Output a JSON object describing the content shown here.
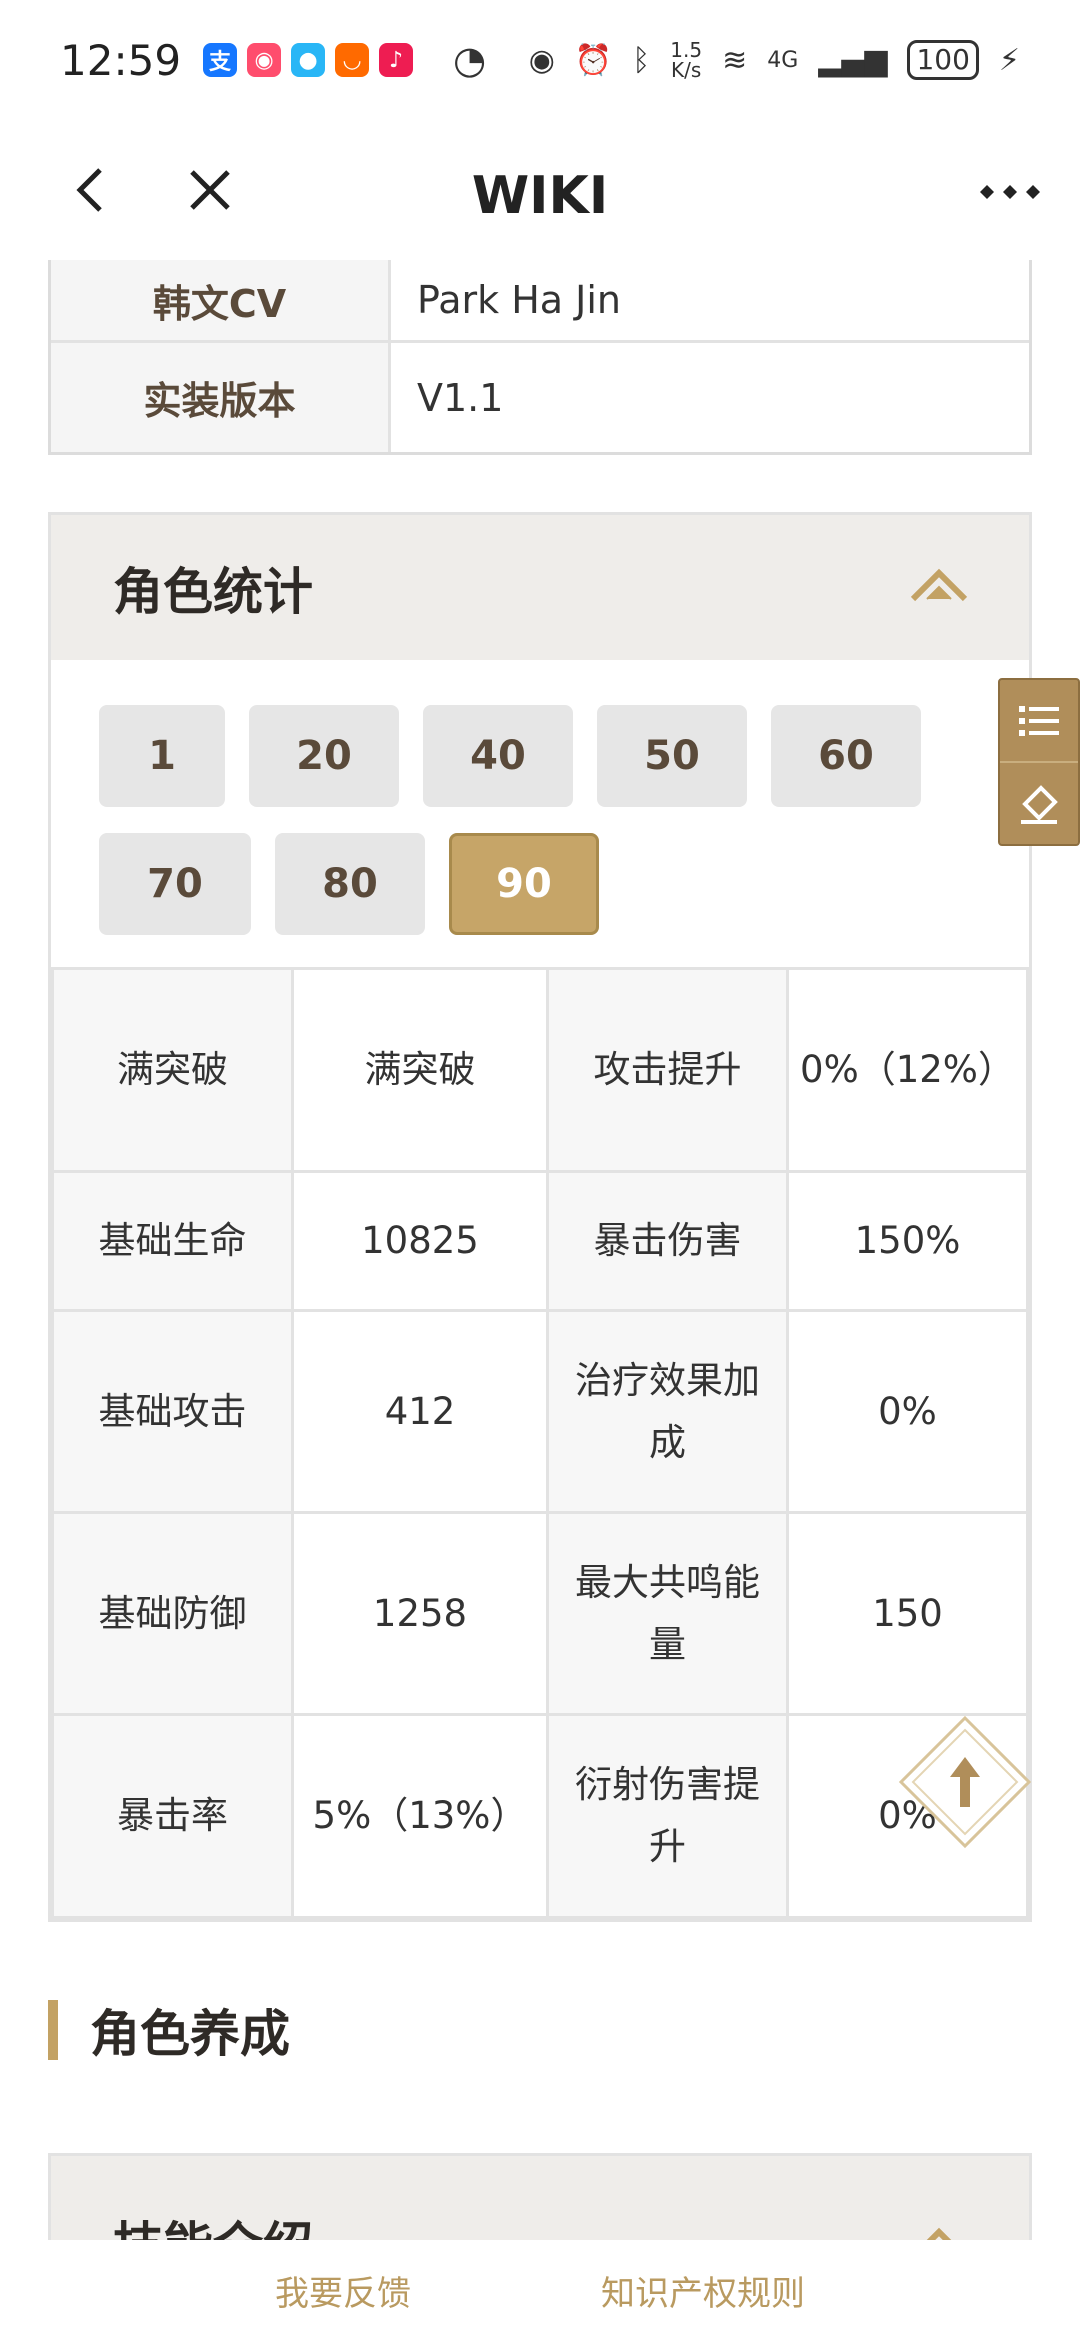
{
  "status_bar": {
    "time": "12:59",
    "apps": [
      {
        "icon": "alipay-icon",
        "glyph": "支",
        "color": "#1677ff"
      },
      {
        "icon": "camera-app-icon",
        "glyph": "◉",
        "color": "#ff4d6d"
      },
      {
        "icon": "cloud-app-icon",
        "glyph": "●",
        "color": "#29b6f6"
      },
      {
        "icon": "taobao-icon",
        "glyph": "◡",
        "color": "#ff6a00"
      },
      {
        "icon": "douyin-icon",
        "glyph": "♪",
        "color": "#ee1d52"
      }
    ],
    "speed_icon": "speedometer-icon",
    "network_speed": "1.5\nK/s",
    "network_type": "4G",
    "battery": "100"
  },
  "nav": {
    "title": "WIKI",
    "back_icon": "back-chevron-icon",
    "close_icon": "close-icon",
    "more_icon": "more-dots-icon"
  },
  "info_table": [
    {
      "label": "韩文CV",
      "value": "Park Ha Jin"
    },
    {
      "label": "实装版本",
      "value": "V1.1"
    }
  ],
  "stats_panel": {
    "title": "角色统计",
    "levels": [
      "1",
      "20",
      "40",
      "50",
      "60",
      "70",
      "80",
      "90"
    ],
    "active_level": "90",
    "rows": [
      [
        "满突破",
        "满突破",
        "攻击提升",
        "0%（12%）"
      ],
      [
        "基础生命",
        "10825",
        "暴击伤害",
        "150%"
      ],
      [
        "基础攻击",
        "412",
        "治疗效果加成",
        "0%"
      ],
      [
        "基础防御",
        "1258",
        "最大共鸣能量",
        "150"
      ],
      [
        "暴击率",
        "5%（13%）",
        "衍射伤害提升",
        "0%"
      ]
    ]
  },
  "section": {
    "title": "角色养成"
  },
  "skills_panel": {
    "title": "技能介绍"
  },
  "side_tools": {
    "list_icon": "list-icon",
    "eraser_icon": "eraser-icon"
  },
  "footer": {
    "feedback": "我要反馈",
    "ip_rules": "知识产权规则"
  },
  "colors": {
    "accent": "#c6a568",
    "panel_head": "#efedea",
    "footer_text": "#b99a60"
  }
}
